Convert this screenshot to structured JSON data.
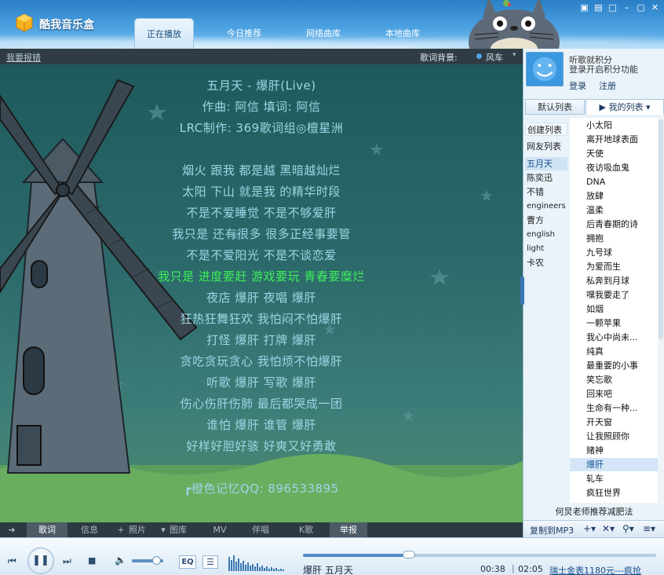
{
  "app": {
    "title": "酷我音乐盒"
  },
  "tabs": [
    "正在播放",
    "今日推荐",
    "网络曲库",
    "本地曲库"
  ],
  "lyrics_header": {
    "report_link": "我要报错",
    "bg_label": "歌词背景:",
    "bg_value": "风车"
  },
  "lyrics": {
    "lines": [
      "五月天 - 爆肝(Live)",
      "作曲: 阿信 填词: 阿信",
      "LRC制作: 369歌词组◎檀星洲",
      "",
      "烟火 跟我 都是越 黑暗越灿烂",
      "太阳 下山 就是我 的精华时段",
      "不是不爱睡觉 不是不够爱肝",
      "我只是 还有很多 很多正经事要管",
      "不是不爱阳光 不是不谈恋爱",
      "我只是 进度要赶 游戏要玩 青春要糜烂",
      "夜店 爆肝 夜唱 爆肝",
      "狂热狂舞狂欢 我怕闷不怕爆肝",
      "打怪 爆肝 打牌 爆肝",
      "贪吃贪玩贪心 我怕烦不怕爆肝",
      "听歌 爆肝 写歌 爆肝",
      "伤心伤肝伤肺 最后都哭成一团",
      "谁怕 爆肝 谁管 爆肝",
      "好样好胆好骇 好爽又好勇敢",
      "",
      "┏橙色记忆QQ: 896533895"
    ],
    "current_index": 9
  },
  "bottom_tabs": [
    "歌词",
    "信息",
    "照片",
    "图库",
    "MV",
    "伴唱",
    "K歌",
    "举报"
  ],
  "bottom_tab_prefixes": [
    "➜",
    "",
    "+",
    "▾",
    "",
    "",
    "",
    ""
  ],
  "sidebar": {
    "promo_line1": "听歌就积分",
    "promo_line2": "登录开启积分功能",
    "login": "登录",
    "register": "注册",
    "tab_default": "默认列表",
    "tab_mine": "▶ 我的列表 ▾",
    "categories": [
      "创建列表",
      "网友列表",
      "五月天",
      "陈奕迅",
      "不错",
      "engineers",
      "曹方",
      "english",
      "light",
      "卡农"
    ],
    "selected_category": 2,
    "songs": [
      "小太阳",
      "离开地球表面",
      "天使",
      "夜访吸血鬼",
      "DNA",
      "放肆",
      "温柔",
      "后青春期的诗",
      "拥抱",
      "九号球",
      "为爱而生",
      "私奔到月球",
      "嘿我要走了",
      "如烟",
      "一颗苹果",
      "我心中尚未...",
      "纯真",
      "最重要的小事",
      "笑忘歌",
      "回来吧",
      "生命有一种...",
      "开天窗",
      "让我照顾你",
      "赌神",
      "爆肝",
      "轧车",
      "疯狂世界"
    ],
    "playing_song": 24,
    "recommend": "何炅老师推荐减肥法",
    "copy_mp3": "复制到MP3"
  },
  "player": {
    "eq": "EQ",
    "now_playing": "爆肝 五月天",
    "time_current": "00:38",
    "time_separator": "|",
    "time_total": "02:05",
    "ad": "瑞士金表1180元---疯抢",
    "progress": 0.3,
    "volume": 0.8
  },
  "colors": {
    "accent": "#4d8cc7",
    "current_lyric": "#3df05a",
    "lyric": "#9dd6e6"
  }
}
